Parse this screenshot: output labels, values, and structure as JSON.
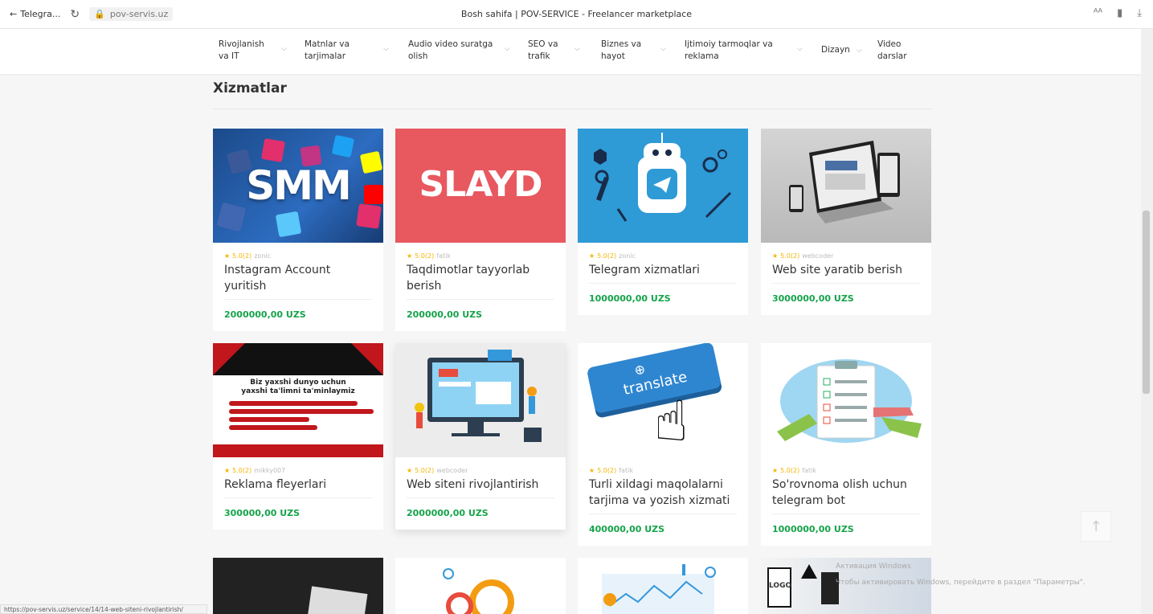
{
  "browser": {
    "back_label": "Telegra...",
    "url": "pov-servis.uz",
    "title": "Bosh sahifa | POV-SERVICE - Freelancer marketplace"
  },
  "nav": {
    "categories": [
      {
        "label": "Rivojlanish va IT"
      },
      {
        "label": "Matnlar va tarjimalar"
      },
      {
        "label": "Audio video suratga olish"
      },
      {
        "label": "SEO va trafik"
      },
      {
        "label": "Biznes va hayot"
      },
      {
        "label": "Ijtimoiy tarmoqlar va reklama"
      },
      {
        "label": "Dizayn"
      },
      {
        "label": "Video darslar"
      }
    ]
  },
  "section": {
    "title": "Xizmatlar"
  },
  "services": [
    {
      "rating": "5.0(2)",
      "author": "zonic",
      "title": "Instagram Account yuritish",
      "price": "2000000,00 UZS",
      "image_text": "SMM"
    },
    {
      "rating": "5.0(2)",
      "author": "fatik",
      "title": "Taqdimotlar tayyorlab berish",
      "price": "200000,00 UZS",
      "image_text": "SLAYD"
    },
    {
      "rating": "5.0(2)",
      "author": "zonic",
      "title": "Telegram xizmatlari",
      "price": "1000000,00 UZS"
    },
    {
      "rating": "5.0(2)",
      "author": "webcoder",
      "title": "Web site yaratib berish",
      "price": "3000000,00 UZS"
    },
    {
      "rating": "5.0(2)",
      "author": "mikky007",
      "title": "Reklama fleyerlari",
      "price": "300000,00 UZS",
      "image_text": "Biz yaxshi dunyo uchun yaxshi ta'limni ta'minlaymiz"
    },
    {
      "rating": "5.0(2)",
      "author": "webcoder",
      "title": "Web siteni rivojlantirish",
      "price": "2000000,00 UZS"
    },
    {
      "rating": "5.0(2)",
      "author": "fatik",
      "title": "Turli xildagi maqolalarni tarjima va yozish xizmati",
      "price": "400000,00 UZS",
      "image_text": "translate"
    },
    {
      "rating": "5.0(2)",
      "author": "fatik",
      "title": "So'rovnoma olish uchun telegram bot",
      "price": "1000000,00 UZS"
    }
  ],
  "statusbar": {
    "url": "https://pov-servis.uz/service/14/14-web-siteni-rivojlantirish/"
  },
  "watermark": {
    "line1": "Активация Windows",
    "line2": "Чтобы активировать Windows, перейдите в раздел \"Параметры\"."
  },
  "colors": {
    "price": "#16a34a",
    "star": "#f5b400",
    "slayd_bg": "#e8585f",
    "telegram_bg": "#2e9ad6"
  }
}
